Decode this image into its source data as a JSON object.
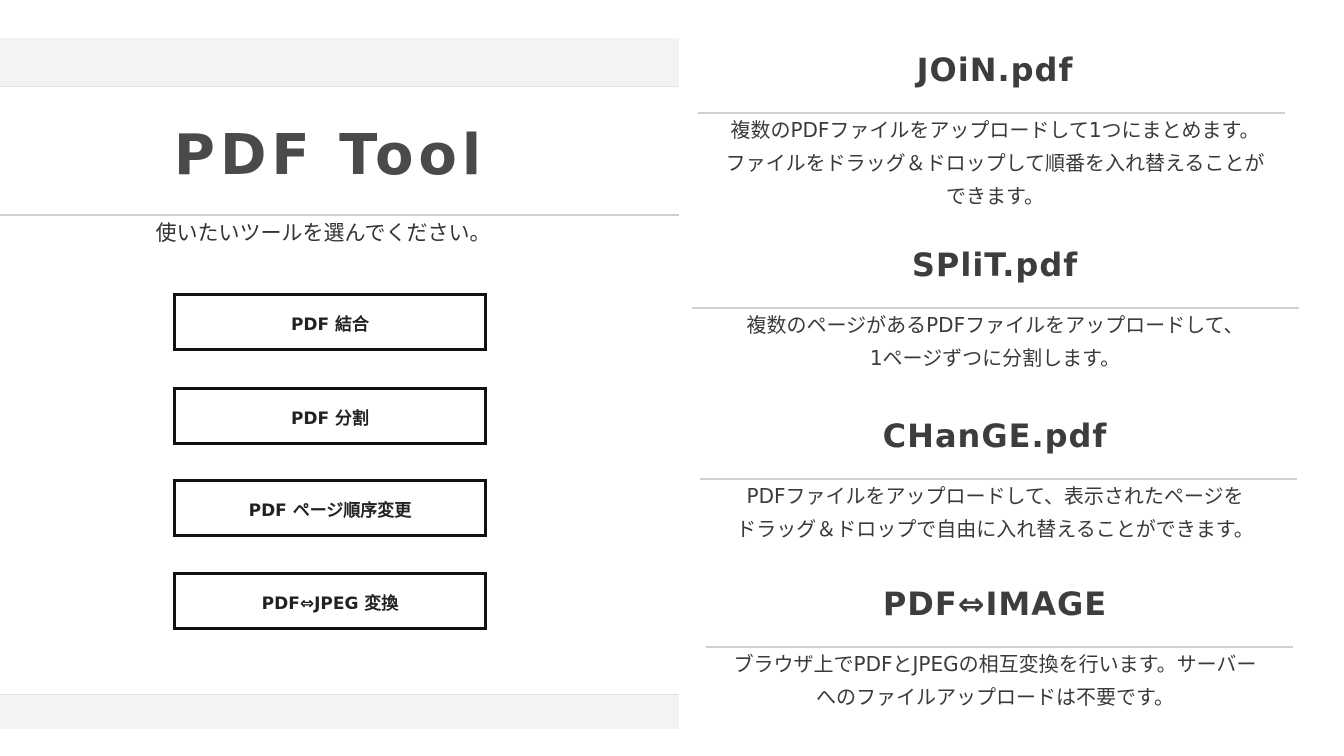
{
  "app": {
    "title": "PDF Tool",
    "subtitle": "使いたいツールを選んでください。"
  },
  "buttons": [
    {
      "label": "PDF 結合"
    },
    {
      "label": "PDF 分割"
    },
    {
      "label": "PDF ページ順序変更"
    },
    {
      "label": "PDF⇔JPEG 変換"
    }
  ],
  "tools": [
    {
      "name": "JOiN.pdf",
      "description_lines": [
        "複数のPDFファイルをアップロードして1つにまとめます。",
        "ファイルをドラッグ＆ドロップして順番を入れ替えることが",
        "できます。"
      ]
    },
    {
      "name": "SPliT.pdf",
      "description_lines": [
        "複数のページがあるPDFファイルをアップロードして、",
        "1ページずつに分割します。"
      ]
    },
    {
      "name": "CHanGE.pdf",
      "description_lines": [
        "PDFファイルをアップロードして、表示されたページを",
        "ドラッグ＆ドロップで自由に入れ替えることができます。"
      ]
    },
    {
      "name": "PDF⇔IMAGE",
      "description_lines": [
        "ブラウザ上でPDFとJPEGの相互変換を行います。サーバー",
        "へのファイルアップロードは不要です。"
      ]
    }
  ]
}
